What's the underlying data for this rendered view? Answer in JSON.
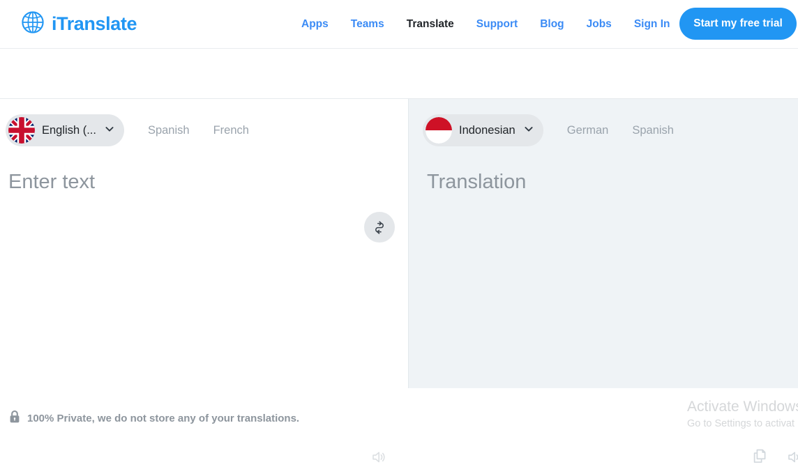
{
  "brand": {
    "name": "iTranslate",
    "logo_icon": "globe-icon",
    "accent_color": "#2196f3"
  },
  "nav": {
    "links": [
      {
        "label": "Apps",
        "active": false
      },
      {
        "label": "Teams",
        "active": false
      },
      {
        "label": "Translate",
        "active": true
      },
      {
        "label": "Support",
        "active": false
      },
      {
        "label": "Blog",
        "active": false
      },
      {
        "label": "Jobs",
        "active": false
      },
      {
        "label": "Sign In",
        "active": false
      }
    ],
    "cta_label": "Start my free trial"
  },
  "translator": {
    "source": {
      "selected_language": "English (...",
      "flag_icon": "flag-uk-icon",
      "chevron_icon": "chevron-down-icon",
      "alternatives": [
        "Spanish",
        "French"
      ],
      "placeholder": "Enter text",
      "value": "",
      "speaker_icon": "speaker-icon"
    },
    "swap": {
      "icon": "swap-arrows-icon",
      "label": "Swap languages"
    },
    "target": {
      "selected_language": "Indonesian",
      "flag_icon": "flag-indonesia-icon",
      "chevron_icon": "chevron-down-icon",
      "alternatives": [
        "German",
        "Spanish"
      ],
      "placeholder": "Translation",
      "value": "",
      "copy_icon": "copy-icon",
      "speaker_icon": "speaker-icon"
    }
  },
  "footer": {
    "lock_icon": "lock-icon",
    "privacy_text": "100% Private, we do not store any of your translations."
  },
  "watermark": {
    "title": "Activate Windows",
    "subtitle": "Go to Settings to activat"
  }
}
